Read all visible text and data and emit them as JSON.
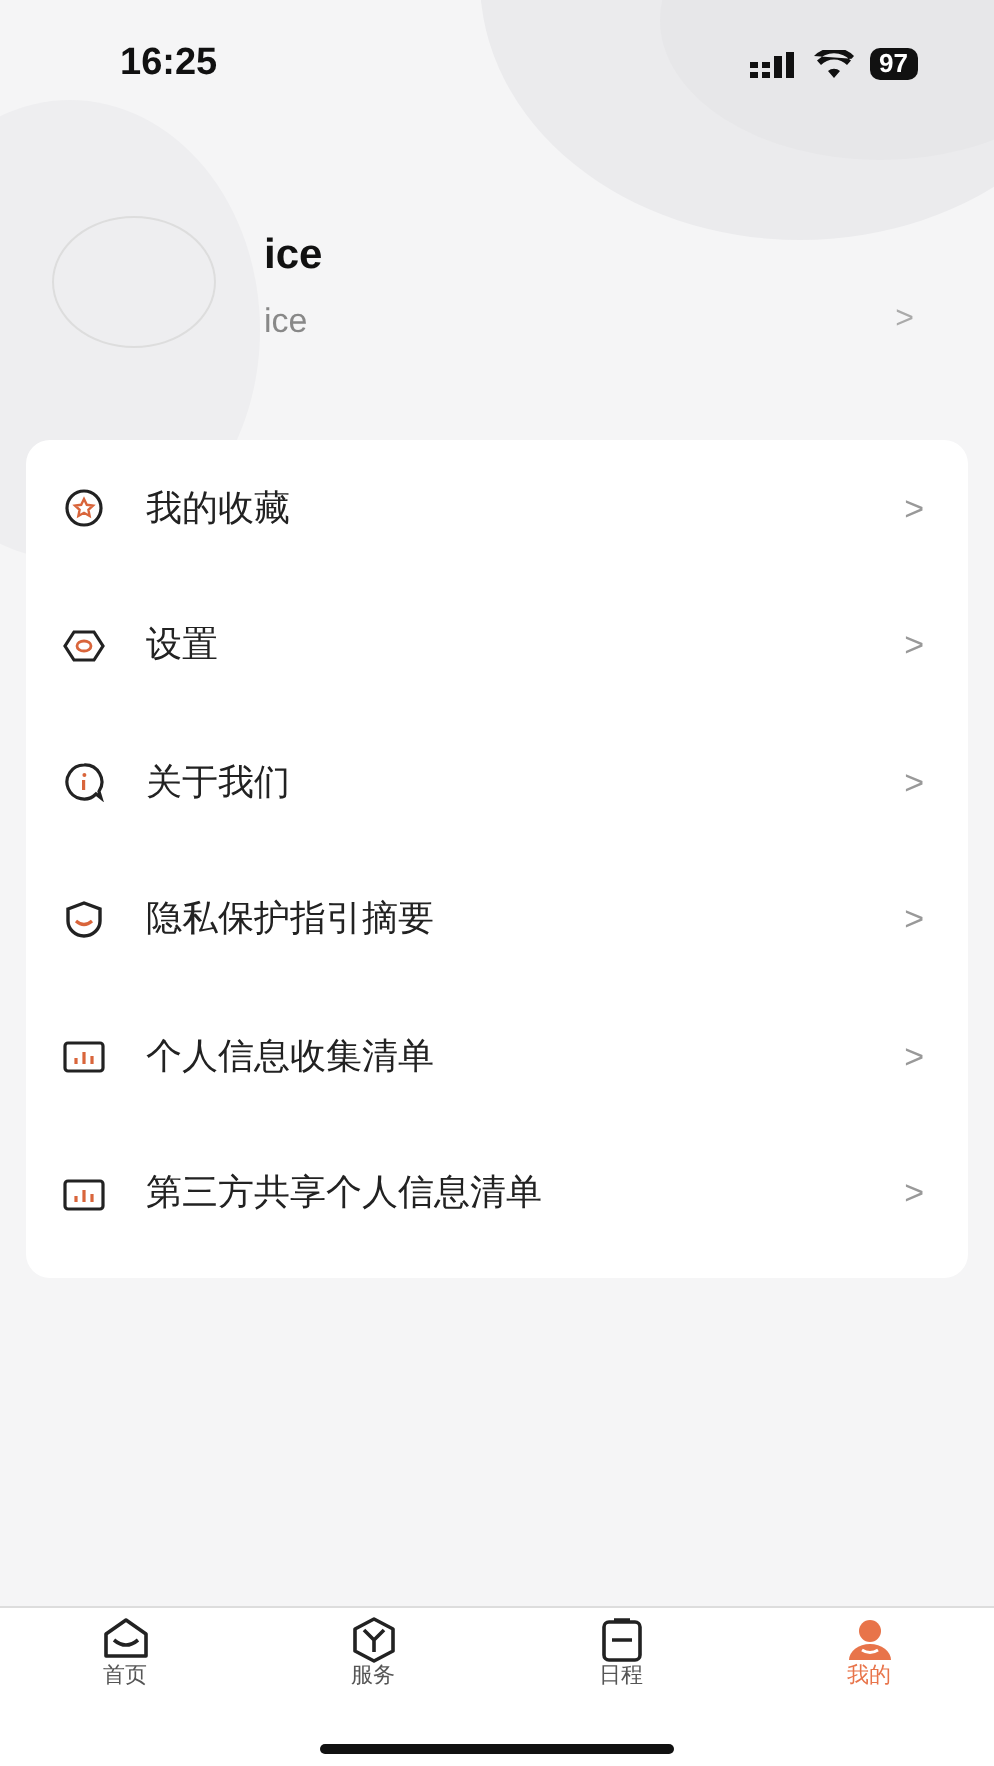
{
  "status_bar": {
    "time": "16:25",
    "battery": "97"
  },
  "profile": {
    "name": "ice",
    "subtitle": "ice",
    "chevron": ">"
  },
  "menu": [
    {
      "kind": "star",
      "label": "我的收藏",
      "chevron": ">"
    },
    {
      "kind": "hexagon",
      "label": "设置",
      "chevron": ">"
    },
    {
      "kind": "info",
      "label": "关于我们",
      "chevron": ">"
    },
    {
      "kind": "shield",
      "label": "隐私保护指引摘要",
      "chevron": ">"
    },
    {
      "kind": "chart",
      "label": "个人信息收集清单",
      "chevron": ">"
    },
    {
      "kind": "chart",
      "label": "第三方共享个人信息清单",
      "chevron": ">"
    }
  ],
  "tab_bar": [
    {
      "kind": "home",
      "label": "首页",
      "selected": false
    },
    {
      "kind": "cube",
      "label": "服务",
      "selected": false
    },
    {
      "kind": "clipboard",
      "label": "日程",
      "selected": false
    },
    {
      "kind": "person",
      "label": "我的",
      "selected": true
    }
  ]
}
